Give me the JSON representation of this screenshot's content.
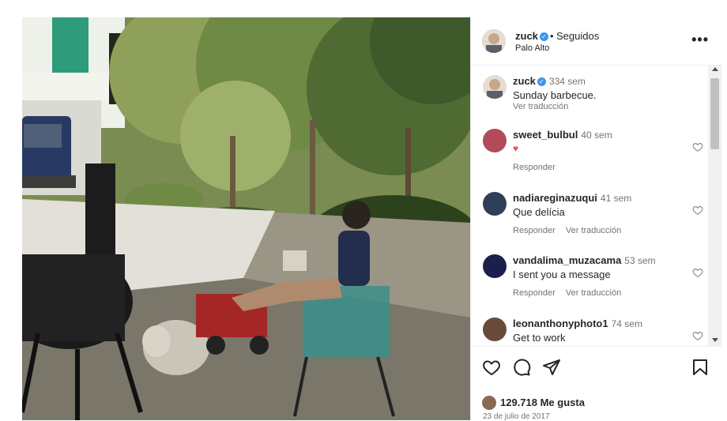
{
  "post": {
    "header": {
      "username": "zuck",
      "separator": "•",
      "follow_status": "Seguidos",
      "location": "Palo Alto",
      "more_label": "•••"
    },
    "caption": {
      "username": "zuck",
      "time": "334 sem",
      "text": "Sunday barbecue.",
      "translate": "Ver traducción"
    },
    "comments": [
      {
        "username": "sweet_bulbul",
        "time": "40 sem",
        "text": "♥",
        "reply": "Responder",
        "translate": ""
      },
      {
        "username": "nadiareginazuqui",
        "time": "41 sem",
        "text": "Que delícia",
        "reply": "Responder",
        "translate": "Ver traducción"
      },
      {
        "username": "vandalima_muzacama",
        "time": "53 sem",
        "text": "I sent you a message",
        "reply": "Responder",
        "translate": "Ver traducción"
      },
      {
        "username": "leonanthonyphoto1",
        "time": "74 sem",
        "text": "Get to work",
        "reply": "",
        "translate": ""
      }
    ],
    "likes": "129.718 Me gusta",
    "date": "23 de julio de 2017",
    "colors": {
      "verified": "#3897f0",
      "heart": "#ed4956",
      "muted": "#737373"
    },
    "icons": [
      "heart-icon",
      "comment-icon",
      "share-icon",
      "bookmark-icon",
      "more-icon",
      "verified-icon"
    ]
  }
}
